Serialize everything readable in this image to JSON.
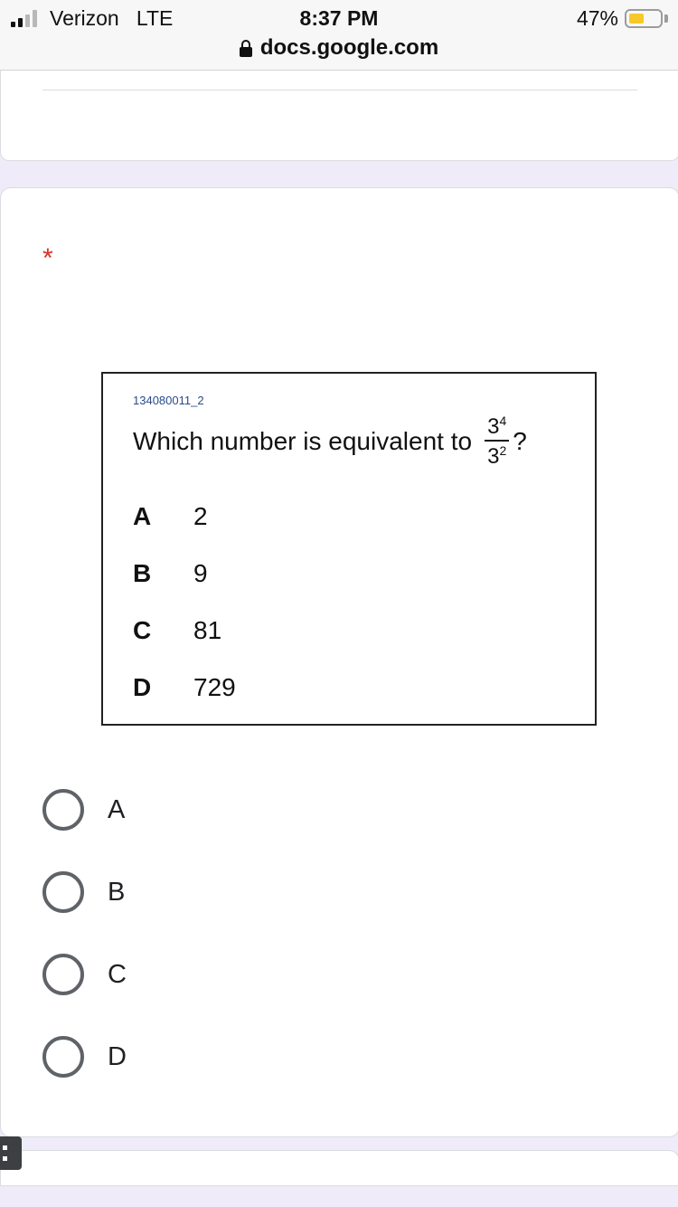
{
  "status_bar": {
    "carrier": "Verizon",
    "network": "LTE",
    "time": "8:37 PM",
    "battery_percent": "47%",
    "battery_level": 0.47,
    "url": "docs.google.com"
  },
  "question": {
    "required_marker": "*",
    "image": {
      "item_id": "134080011_2",
      "stem": "Which number is equivalent to",
      "numerator_base": "3",
      "numerator_exp": "4",
      "denominator_base": "3",
      "denominator_exp": "2",
      "end_mark": "?",
      "options": [
        {
          "letter": "A",
          "value": "2"
        },
        {
          "letter": "B",
          "value": "9"
        },
        {
          "letter": "C",
          "value": "81"
        },
        {
          "letter": "D",
          "value": "729"
        }
      ]
    },
    "choices": [
      "A",
      "B",
      "C",
      "D"
    ]
  },
  "colors": {
    "page_background": "#f0ebf8",
    "required": "#d93025",
    "radio_border": "#5f6368",
    "battery_fill": "#f7c928"
  }
}
